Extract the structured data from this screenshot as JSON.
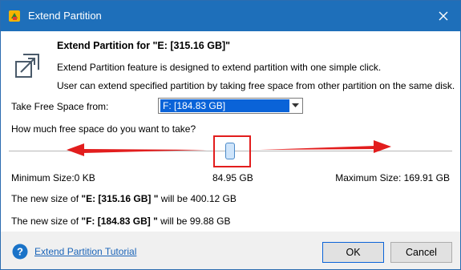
{
  "window": {
    "title": "Extend Partition",
    "titlebar_color": "#1e6fba",
    "close_icon": "close-icon"
  },
  "header": {
    "heading": "Extend Partition for \"E: [315.16 GB]\"",
    "description_1": "Extend Partition feature is designed to extend partition with one simple click.",
    "description_2": "User can extend specified partition by taking free space from other partition on the same disk.",
    "icon": "extend-icon"
  },
  "source": {
    "label": "Take Free Space from:",
    "selected_value": "F:  [184.83 GB]"
  },
  "slider": {
    "question": "How much free space do you want to take?",
    "min_label": "Minimum Size:0 KB",
    "current_value": "84.95 GB",
    "max_label": "Maximum Size: 169.91 GB",
    "position_fraction": 0.5,
    "annotation_color": "#e21d1d"
  },
  "results": {
    "e_prefix": "The new size of ",
    "e_partition": "\"E: [315.16 GB] \"",
    "e_suffix": " will be 400.12 GB",
    "f_prefix": "The new size of ",
    "f_partition": "\"F: [184.83 GB] \"",
    "f_suffix": " will be 99.88 GB"
  },
  "footer": {
    "tutorial_link": "Extend Partition Tutorial",
    "ok_label": "OK",
    "cancel_label": "Cancel",
    "help_icon": "help-icon"
  }
}
